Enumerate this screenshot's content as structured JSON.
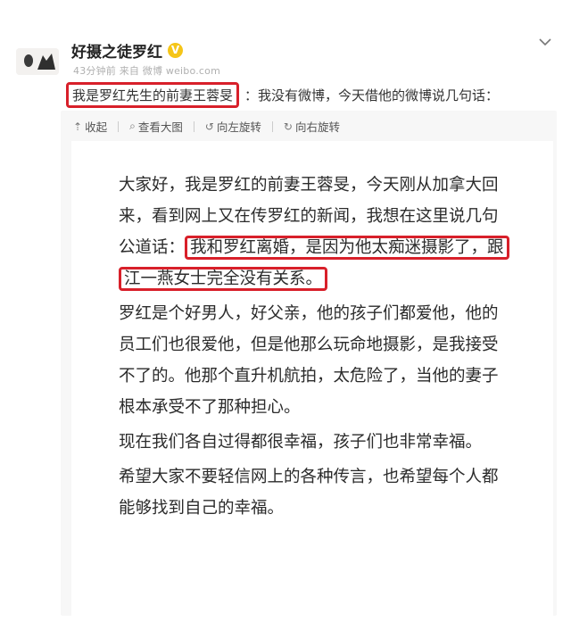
{
  "post": {
    "username": "好摄之徒罗红",
    "verified_badge": "V",
    "meta": "43分钟前 来自 微博 weibo.com",
    "highlight_text": "我是罗红先生的前妻王蓉旻",
    "rest_text": "：我没有微博，今天借他的微博说几句话："
  },
  "toolbar": {
    "collapse": "收起",
    "view_large": "查看大图",
    "rotate_left": "向左旋转",
    "rotate_right": "向右旋转"
  },
  "letter": {
    "p1_l1": "大家好，我是罗红的前妻王蓉旻，今天刚从加拿大回",
    "p1_l2": "来，看到网上又在传罗红的新闻，我想在这里说几句",
    "p1_l3_a": "公道话：",
    "p1_l3_hl": "我和罗红离婚，是因为他太痴迷摄影了，跟",
    "p1_l4_hl": "江一燕女士完全没有关系。",
    "p2_l1": "罗红是个好男人，好父亲，他的孩子们都爱他，他的",
    "p2_l2": "员工们也很爱他，但是他那么玩命地摄影，是我接受",
    "p2_l3": "不了的。他那个直升机航拍，太危险了，当他的妻子",
    "p2_l4": "根本承受不了那种担心。",
    "p3_l1": "现在我们各自过得都很幸福，孩子们也非常幸福。",
    "p4_l1": "希望大家不要轻信网上的各种传言，也希望每个人都",
    "p4_l2": "能够找到自己的幸福。"
  },
  "colors": {
    "highlight_border": "#d8202a",
    "verified_badge": "#f5c518",
    "meta_text": "#b0b0b0"
  }
}
